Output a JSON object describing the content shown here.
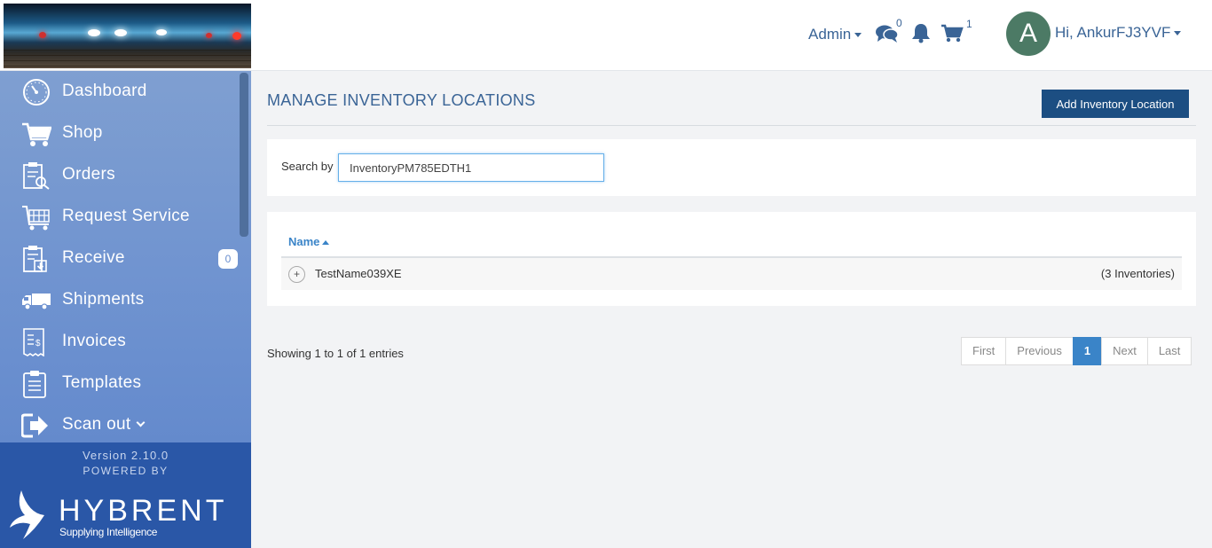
{
  "header": {
    "admin_label": "Admin",
    "messages_count": "0",
    "cart_count": "1",
    "avatar_initial": "A",
    "greeting": "Hi, AnkurFJ3YVF"
  },
  "sidebar": {
    "items": [
      {
        "label": "Dashboard",
        "icon": "dashboard-icon"
      },
      {
        "label": "Shop",
        "icon": "cart-icon"
      },
      {
        "label": "Orders",
        "icon": "orders-icon"
      },
      {
        "label": "Request Service",
        "icon": "request-service-icon"
      },
      {
        "label": "Receive",
        "icon": "receive-icon",
        "badge": "0"
      },
      {
        "label": "Shipments",
        "icon": "truck-icon"
      },
      {
        "label": "Invoices",
        "icon": "invoice-icon"
      },
      {
        "label": "Templates",
        "icon": "templates-icon"
      },
      {
        "label": "Scan out",
        "icon": "scan-out-icon"
      }
    ],
    "version": "Version 2.10.0",
    "powered_by": "POWERED BY",
    "brand": "HYBRENT",
    "tagline": "Supplying Intelligence"
  },
  "main": {
    "title": "MANAGE INVENTORY LOCATIONS",
    "add_button": "Add Inventory Location",
    "search_label": "Search by",
    "search_value": "InventoryPM785EDTH1",
    "table": {
      "column_name": "Name",
      "rows": [
        {
          "expand": "+",
          "name": "TestName039XE",
          "count": "(3 Inventories)"
        }
      ]
    },
    "showing": "Showing 1 to 1 of 1 entries",
    "pagination": {
      "first": "First",
      "previous": "Previous",
      "current": "1",
      "next": "Next",
      "last": "Last"
    }
  },
  "colors": {
    "accent": "#3a6496",
    "button": "#1c4e82",
    "sidebar": "#6a8fcf",
    "sidebar_footer": "#2a57a7",
    "link": "#3a84c8"
  }
}
